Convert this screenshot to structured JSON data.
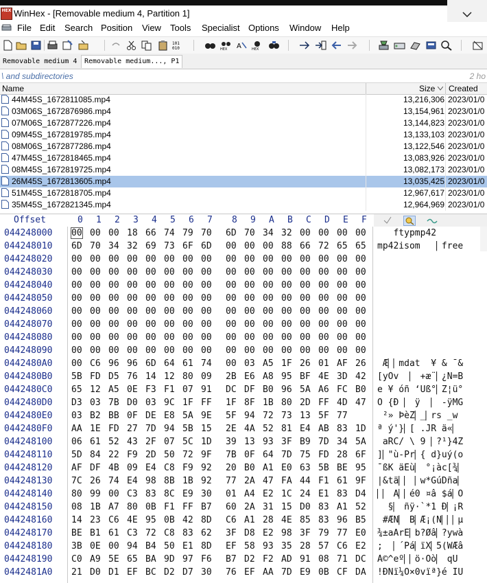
{
  "window": {
    "title": "WinHex - [Removable medium 4, Partition 1]",
    "app_icon_text": "HEX"
  },
  "menu": [
    "File",
    "Edit",
    "Search",
    "Position",
    "View",
    "Tools",
    "Specialist",
    "Options",
    "Window",
    "Help"
  ],
  "tabs": [
    {
      "label": "Removable medium 4",
      "active": false
    },
    {
      "label": "Removable medium..., P1",
      "active": true
    }
  ],
  "filter": {
    "text": "\\ and subdirectories",
    "right": "2 ho"
  },
  "columns": {
    "name": "Name",
    "size": "Size",
    "created": "Created"
  },
  "files": [
    {
      "name": "44M45S_1672811085.mp4",
      "size": "13,216,306",
      "created": "2023/01/0"
    },
    {
      "name": "03M06S_1672876986.mp4",
      "size": "13,154,961",
      "created": "2023/01/0"
    },
    {
      "name": "07M06S_1672877226.mp4",
      "size": "13,144,823",
      "created": "2023/01/0"
    },
    {
      "name": "09M45S_1672819785.mp4",
      "size": "13,133,103",
      "created": "2023/01/0"
    },
    {
      "name": "08M06S_1672877286.mp4",
      "size": "13,122,546",
      "created": "2023/01/0"
    },
    {
      "name": "47M45S_1672818465.mp4",
      "size": "13,083,926",
      "created": "2023/01/0"
    },
    {
      "name": "08M45S_1672819725.mp4",
      "size": "13,082,173",
      "created": "2023/01/0"
    },
    {
      "name": "26M45S_1672813605.mp4",
      "size": "13,035,425",
      "created": "2023/01/0",
      "selected": true
    },
    {
      "name": "51M45S_1672818705.mp4",
      "size": "12,967,617",
      "created": "2023/01/0"
    },
    {
      "name": "35M45S_1672821345.mp4",
      "size": "12,964,969",
      "created": "2023/01/0"
    }
  ],
  "hex": {
    "offset_label": "Offset",
    "col_headers": [
      "0",
      "1",
      "2",
      "3",
      "4",
      "5",
      "6",
      "7",
      "8",
      "9",
      "A",
      "B",
      "C",
      "D",
      "E",
      "F"
    ],
    "rows": [
      {
        "offset": "044248000",
        "bytes": [
          "00",
          "00",
          "00",
          "18",
          "66",
          "74",
          "79",
          "70",
          "6D",
          "70",
          "34",
          "32",
          "00",
          "00",
          "00",
          "00"
        ],
        "text": "   ftypmp42"
      },
      {
        "offset": "044248010",
        "bytes": [
          "6D",
          "70",
          "34",
          "32",
          "69",
          "73",
          "6F",
          "6D",
          "00",
          "00",
          "00",
          "88",
          "66",
          "72",
          "65",
          "65"
        ],
        "text": "mp42isom   ▏free"
      },
      {
        "offset": "044248020",
        "bytes": [
          "00",
          "00",
          "00",
          "00",
          "00",
          "00",
          "00",
          "00",
          "00",
          "00",
          "00",
          "00",
          "00",
          "00",
          "00",
          "00"
        ],
        "text": ""
      },
      {
        "offset": "044248030",
        "bytes": [
          "00",
          "00",
          "00",
          "00",
          "00",
          "00",
          "00",
          "00",
          "00",
          "00",
          "00",
          "00",
          "00",
          "00",
          "00",
          "00"
        ],
        "text": ""
      },
      {
        "offset": "044248040",
        "bytes": [
          "00",
          "00",
          "00",
          "00",
          "00",
          "00",
          "00",
          "00",
          "00",
          "00",
          "00",
          "00",
          "00",
          "00",
          "00",
          "00"
        ],
        "text": ""
      },
      {
        "offset": "044248050",
        "bytes": [
          "00",
          "00",
          "00",
          "00",
          "00",
          "00",
          "00",
          "00",
          "00",
          "00",
          "00",
          "00",
          "00",
          "00",
          "00",
          "00"
        ],
        "text": ""
      },
      {
        "offset": "044248060",
        "bytes": [
          "00",
          "00",
          "00",
          "00",
          "00",
          "00",
          "00",
          "00",
          "00",
          "00",
          "00",
          "00",
          "00",
          "00",
          "00",
          "00"
        ],
        "text": ""
      },
      {
        "offset": "044248070",
        "bytes": [
          "00",
          "00",
          "00",
          "00",
          "00",
          "00",
          "00",
          "00",
          "00",
          "00",
          "00",
          "00",
          "00",
          "00",
          "00",
          "00"
        ],
        "text": ""
      },
      {
        "offset": "044248080",
        "bytes": [
          "00",
          "00",
          "00",
          "00",
          "00",
          "00",
          "00",
          "00",
          "00",
          "00",
          "00",
          "00",
          "00",
          "00",
          "00",
          "00"
        ],
        "text": ""
      },
      {
        "offset": "044248090",
        "bytes": [
          "00",
          "00",
          "00",
          "00",
          "00",
          "00",
          "00",
          "00",
          "00",
          "00",
          "00",
          "00",
          "00",
          "00",
          "00",
          "00"
        ],
        "text": ""
      },
      {
        "offset": "0442480A0",
        "bytes": [
          "00",
          "C6",
          "96",
          "96",
          "6D",
          "64",
          "61",
          "74",
          "00",
          "03",
          "A5",
          "1F",
          "26",
          "01",
          "AF",
          "26"
        ],
        "text": " Æ▏▏mdat  ¥ & ¯&"
      },
      {
        "offset": "0442480B0",
        "bytes": [
          "5B",
          "FD",
          "D5",
          "76",
          "14",
          "12",
          "80",
          "09",
          "2B",
          "E6",
          "A8",
          "95",
          "BF",
          "4E",
          "3D",
          "42"
        ],
        "text": "[yÕv  ▏ +æ¨▏¿N=B"
      },
      {
        "offset": "0442480C0",
        "bytes": [
          "65",
          "12",
          "A5",
          "0E",
          "F3",
          "F1",
          "07",
          "91",
          "DC",
          "DF",
          "B0",
          "96",
          "5A",
          "A6",
          "FC",
          "B0"
        ],
        "text": "e ¥ óñ ‘Üß°▏Z¦ü°"
      },
      {
        "offset": "0442480D0",
        "bytes": [
          "D3",
          "03",
          "7B",
          "D0",
          "03",
          "9C",
          "1F",
          "FF",
          "1F",
          "8F",
          "1B",
          "80",
          "2D",
          "FF",
          "4D",
          "47"
        ],
        "text": "Ó {Ð ▏ ÿ  ▏ -ÿMG"
      },
      {
        "offset": "0442480E0",
        "bytes": [
          "03",
          "B2",
          "BB",
          "0F",
          "DE",
          "E8",
          "5A",
          "9E",
          "5F",
          "94",
          "72",
          "73",
          "13",
          "5F",
          "77"
        ],
        "text": " ²» ÞèZ▏_▏rs _w"
      },
      {
        "offset": "0442480F0",
        "bytes": [
          "AA",
          "1E",
          "FD",
          "27",
          "7D",
          "94",
          "5B",
          "15",
          "2E",
          "4A",
          "52",
          "81",
          "E4",
          "AB",
          "83",
          "1D"
        ],
        "text": "ª ý'}▏[ .JR ä«▏"
      },
      {
        "offset": "044248100",
        "bytes": [
          "06",
          "61",
          "52",
          "43",
          "2F",
          "07",
          "5C",
          "1D",
          "39",
          "13",
          "93",
          "3F",
          "B9",
          "7D",
          "34",
          "5A"
        ],
        "text": " aRC/ \\ 9 ▏?¹}4Z"
      },
      {
        "offset": "044248110",
        "bytes": [
          "5D",
          "84",
          "22",
          "F9",
          "2D",
          "50",
          "72",
          "9F",
          "7B",
          "0F",
          "64",
          "7D",
          "75",
          "FD",
          "28",
          "6F"
        ],
        "text": "]▏\"ù-Pr▏{ d}uý(o"
      },
      {
        "offset": "044248120",
        "bytes": [
          "AF",
          "DF",
          "4B",
          "09",
          "E4",
          "C8",
          "F9",
          "92",
          "20",
          "B0",
          "A1",
          "E0",
          "63",
          "5B",
          "BE",
          "95"
        ],
        "text": "¯ßK äÈù▏ °¡àc[¾▏"
      },
      {
        "offset": "044248130",
        "bytes": [
          "7C",
          "26",
          "74",
          "E4",
          "98",
          "8B",
          "1B",
          "92",
          "77",
          "2A",
          "47",
          "FA",
          "44",
          "F1",
          "61",
          "9F"
        ],
        "text": "|&tä▏▏ ▏w*GúDña▏"
      },
      {
        "offset": "044248140",
        "bytes": [
          "80",
          "99",
          "00",
          "C3",
          "83",
          "8C",
          "E9",
          "30",
          "01",
          "A4",
          "E2",
          "1C",
          "24",
          "E1",
          "83",
          "D4"
        ],
        "text": "▏▏ Ã▏▏é0 ¤â $á▏Ô"
      },
      {
        "offset": "044248150",
        "bytes": [
          "08",
          "1B",
          "A7",
          "80",
          "0B",
          "F1",
          "FF",
          "B7",
          "60",
          "2A",
          "31",
          "15",
          "D0",
          "83",
          "A1",
          "52"
        ],
        "text": "  §▏ ñÿ·`*1 Ð▏¡R"
      },
      {
        "offset": "044248160",
        "bytes": [
          "14",
          "23",
          "C6",
          "4E",
          "95",
          "0B",
          "42",
          "8D",
          "C6",
          "A1",
          "28",
          "4E",
          "85",
          "83",
          "96",
          "B5"
        ],
        "text": " #ÆN▏ B▏Æ¡(N▏▏▏µ"
      },
      {
        "offset": "044248170",
        "bytes": [
          "BE",
          "B1",
          "61",
          "C3",
          "72",
          "C8",
          "83",
          "62",
          "3F",
          "D8",
          "E2",
          "98",
          "3F",
          "79",
          "77",
          "E0"
        ],
        "text": "¾±aÃrÈ▏b?Øâ▏?ywà"
      },
      {
        "offset": "044248180",
        "bytes": [
          "3B",
          "0E",
          "00",
          "94",
          "B4",
          "50",
          "E1",
          "8D",
          "EF",
          "58",
          "93",
          "35",
          "28",
          "57",
          "C6",
          "E2"
        ],
        "text": ";  ▏´Pá▏ïX▏5(WÆâ"
      },
      {
        "offset": "044248190",
        "bytes": [
          "C0",
          "A9",
          "5E",
          "65",
          "BA",
          "9D",
          "97",
          "F6",
          "B7",
          "D2",
          "F2",
          "AD",
          "91",
          "08",
          "71",
          "DC"
        ],
        "text": "À©^eº▏▏ö·Òò­▏ qÜ"
      },
      {
        "offset": "0442481A0",
        "bytes": [
          "21",
          "D0",
          "D1",
          "EF",
          "BC",
          "D2",
          "D7",
          "30",
          "76",
          "EF",
          "AA",
          "7D",
          "E9",
          "0B",
          "CF",
          "DA"
        ],
        "text": "!ÐÑï¼Ò×0vïª}é ÏÚ"
      }
    ]
  },
  "colors": {
    "selection": "#a9c6ea",
    "offset_text": "#1a2e8c",
    "filter_text": "#4a6fa8"
  }
}
